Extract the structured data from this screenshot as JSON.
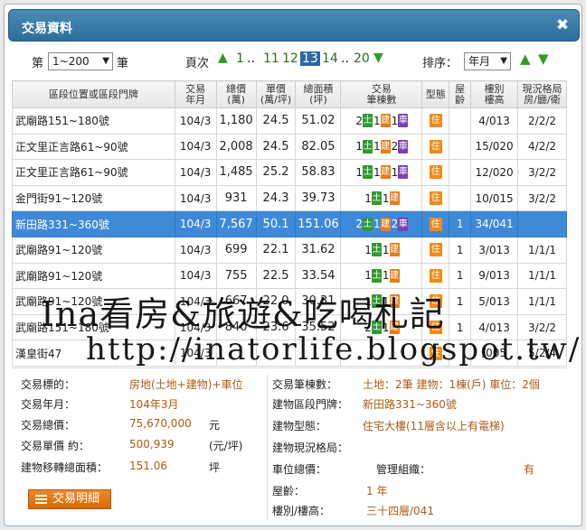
{
  "window": {
    "title": "交易資料",
    "close_glyph": "✖"
  },
  "controls": {
    "prefix": "第",
    "range_value": "1~200",
    "suffix": "筆",
    "page_label": "頁次",
    "pages": [
      "1",
      "..",
      "11",
      "12",
      "13",
      "14",
      "..",
      "20"
    ],
    "current_page": "13",
    "sort_label": "排序：",
    "sort_value": "年月"
  },
  "table": {
    "headers": [
      "區段位置或區段門牌",
      "交易\n年月",
      "總價\n(萬)",
      "單價\n(萬/坪)",
      "總面積\n(坪)",
      "交易\n筆棟數",
      "型態",
      "屋\n齡",
      "樓別\n樓高",
      "現況格局\n房/廳/衛"
    ],
    "rows": [
      {
        "addr": "武廟路151~180號",
        "ym": "104/3",
        "total": "1,180",
        "unit": "24.5",
        "area": "51.02",
        "land": "2",
        "build": "1",
        "car": "1",
        "type": "住",
        "age": "",
        "floor": "4/013",
        "layout": "2/2/2"
      },
      {
        "addr": "正文里正言路61~90號",
        "ym": "104/3",
        "total": "2,008",
        "unit": "24.5",
        "area": "82.05",
        "land": "1",
        "build": "1",
        "car": "2",
        "type": "住",
        "age": "",
        "floor": "15/020",
        "layout": "4/2/2"
      },
      {
        "addr": "正文里正言路61~90號",
        "ym": "104/3",
        "total": "1,485",
        "unit": "25.2",
        "area": "58.83",
        "land": "1",
        "build": "1",
        "car": "1",
        "type": "住",
        "age": "",
        "floor": "12/020",
        "layout": "3/2/2"
      },
      {
        "addr": "金門街91~120號",
        "ym": "104/3",
        "total": "931",
        "unit": "24.3",
        "area": "39.73",
        "land": "1",
        "build": "1",
        "car": "",
        "type": "住",
        "age": "",
        "floor": "10/015",
        "layout": "3/2/2"
      },
      {
        "addr": "新田路331~360號",
        "ym": "104/3",
        "total": "7,567",
        "unit": "50.1",
        "area": "151.06",
        "land": "2",
        "build": "1",
        "car": "2",
        "type": "住",
        "age": "1",
        "floor": "34/041",
        "layout": "",
        "selected": true
      },
      {
        "addr": "武廟路91~120號",
        "ym": "104/3",
        "total": "699",
        "unit": "22.1",
        "area": "31.62",
        "land": "1",
        "build": "1",
        "car": "",
        "type": "住",
        "age": "1",
        "floor": "3/013",
        "layout": "1/1/1"
      },
      {
        "addr": "武廟路91~120號",
        "ym": "104/3",
        "total": "755",
        "unit": "22.5",
        "area": "33.54",
        "land": "1",
        "build": "1",
        "car": "",
        "type": "住",
        "age": "1",
        "floor": "9/013",
        "layout": "1/1/1"
      },
      {
        "addr": "武廟路91~120號",
        "ym": "104/3",
        "total": "667",
        "unit": "22.0",
        "area": "30.31",
        "land": "1",
        "build": "1",
        "car": "",
        "type": "住",
        "age": "1",
        "floor": "5/013",
        "layout": "1/1/1"
      },
      {
        "addr": "武廟路151~180號",
        "ym": "104/3",
        "total": "840",
        "unit": "23.6",
        "area": "35.52",
        "land": "2",
        "build": "1",
        "car": "",
        "type": "住",
        "age": "1",
        "floor": "4/013",
        "layout": "3/2/2"
      },
      {
        "addr": "漢皇街47",
        "ym": "104/3",
        "total": "",
        "unit": "",
        "area": "",
        "land": "",
        "build": "",
        "car": "",
        "type": "住",
        "age": "",
        "floor": "/005",
        "layout": "5/2/4"
      }
    ],
    "badge_land": "土",
    "badge_build": "建",
    "badge_car": "車"
  },
  "watermark": {
    "line1": "Ina看房&旅遊&吃喝札記",
    "line2": "http://inatorlife.blogspot.tw/"
  },
  "info_left": {
    "target_label": "交易標的：",
    "target_value": "房地(土地+建物)+車位",
    "ym_label": "交易年月：",
    "ym_value": "104年3月",
    "total_label": "交易總價：",
    "total_value": "75,670,000",
    "total_unit": "元",
    "unit_label": "交易單價 約：",
    "unit_value": "500,939",
    "unit_unit": "(元/坪)",
    "area_label": "建物移轉總面積：",
    "area_value": "151.06",
    "area_unit": "坪"
  },
  "info_right": {
    "count_label": "交易筆棟數：",
    "count_value": "土地：2筆 建物：1棟(戶) 車位：2個",
    "addr_label": "建物區段門牌：",
    "addr_value": "新田路331~360號",
    "type_label": "建物型態：",
    "type_value": "住宅大樓(11層含以上有電梯)",
    "layout_label": "建物現況格局：",
    "layout_value": "",
    "park_label": "車位總價：",
    "mgmt_label": "管理組織：",
    "mgmt_value": "有",
    "age_label": "屋齡：",
    "age_value": "1 年",
    "floor_label": "樓別/樓高：",
    "floor_value": "三十四層/041"
  },
  "detail_button": {
    "label": "交易明細"
  },
  "colors": {
    "titlebar": "#2c6d9a",
    "selected_row": "#3f8ad8",
    "value_text": "#b05a12",
    "land_badge": "#2f9a2f",
    "build_badge": "#e57e1c",
    "car_badge": "#7b3fb0",
    "detail_button": "#e57e1c"
  }
}
